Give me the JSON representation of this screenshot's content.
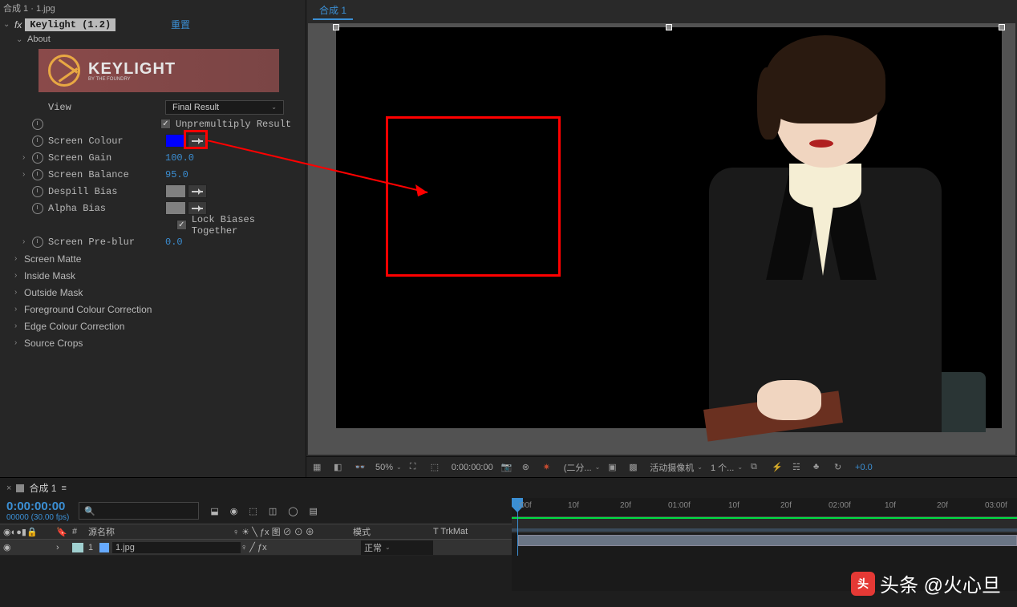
{
  "effects_panel": {
    "header": "合成 1 · 1.jpg",
    "effect_name": "Keylight (1.2)",
    "reset": "重置",
    "about": "About",
    "logo_text": "KEYLIGHT",
    "logo_sub": "BY THE FOUNDRY",
    "view_label": "View",
    "view_value": "Final Result",
    "unpremult_label": "Unpremultiply Result",
    "screen_colour_label": "Screen Colour",
    "screen_colour_value": "#0000FF",
    "screen_gain_label": "Screen Gain",
    "screen_gain_value": "100.0",
    "screen_balance_label": "Screen Balance",
    "screen_balance_value": "95.0",
    "despill_label": "Despill Bias",
    "alpha_bias_label": "Alpha Bias",
    "lock_biases_label": "Lock Biases Together",
    "preblur_label": "Screen Pre-blur",
    "preblur_value": "0.0",
    "sections": [
      "Screen Matte",
      "Inside Mask",
      "Outside Mask",
      "Foreground Colour Correction",
      "Edge Colour Correction",
      "Source Crops"
    ]
  },
  "preview": {
    "tab": "合成 1",
    "toolbar": {
      "zoom": "50%",
      "timecode": "0:00:00:00",
      "res": "(二分...",
      "camera": "活动摄像机",
      "views": "1 个...",
      "exposure": "+0.0"
    }
  },
  "timeline": {
    "tab": "合成 1",
    "timecode": "0:00:00:00",
    "fps": "00000 (30.00 fps)",
    "col_source": "源名称",
    "col_switches": "♀ ☀ ╲ ƒx 图 ⊘ ⊙ ⊕",
    "col_mode": "模式",
    "col_trkmat": "T  TrkMat",
    "layer": {
      "index": "1",
      "name": "1.jpg",
      "switches": "♀  ╱ ƒx",
      "mode": "正常"
    },
    "ruler": [
      ":00f",
      "10f",
      "20f",
      "01:00f",
      "10f",
      "20f",
      "02:00f",
      "10f",
      "20f",
      "03:00f"
    ]
  },
  "watermark": "头条 @火心旦"
}
